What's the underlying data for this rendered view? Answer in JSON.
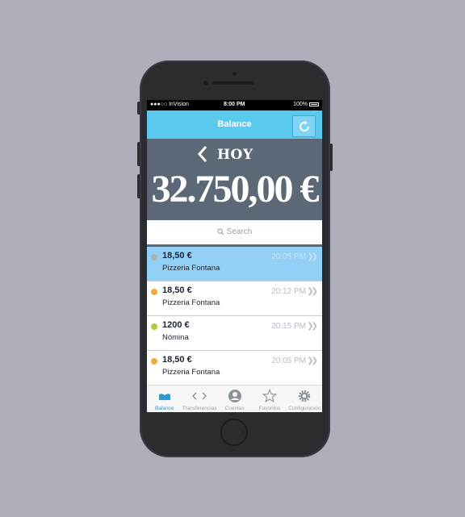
{
  "status_bar": {
    "carrier": "●●●○○ InVision",
    "time": "8:00 PM",
    "battery": "100%"
  },
  "nav": {
    "title": "Balance",
    "refresh_icon": "refresh-icon"
  },
  "hero": {
    "label": "HOY",
    "amount": "32.750,00 €"
  },
  "search": {
    "placeholder": "Search"
  },
  "transactions": [
    {
      "amount": "18,50 €",
      "merchant": "Pizzeria Fontana",
      "time": "20:05 PM",
      "dot_color": "#a9b4ae",
      "selected": true
    },
    {
      "amount": "18,50 €",
      "merchant": "Pizzeria Fontana",
      "time": "20:12 PM",
      "dot_color": "#f0a93a",
      "selected": false
    },
    {
      "amount": "1200 €",
      "merchant": "Nómina",
      "time": "20:15 PM",
      "dot_color": "#a6cf3a",
      "selected": false
    },
    {
      "amount": "18,50 €",
      "merchant": "Pizzeria Fontana",
      "time": "20:05 PM",
      "dot_color": "#f0a93a",
      "selected": false
    }
  ],
  "tabs": [
    {
      "label": "Balance",
      "icon": "balance-icon",
      "active": true
    },
    {
      "label": "Transferencias",
      "icon": "transfer-icon",
      "active": false
    },
    {
      "label": "Cuentas",
      "icon": "account-icon",
      "active": false
    },
    {
      "label": "Favoritos",
      "icon": "star-icon",
      "active": false
    },
    {
      "label": "Configuración",
      "icon": "gear-icon",
      "active": false
    }
  ],
  "colors": {
    "accent": "#5bc8ee",
    "hero_bg": "#5c6876",
    "selected_row": "#92d0f6",
    "tab_active": "#2d9ad6"
  }
}
